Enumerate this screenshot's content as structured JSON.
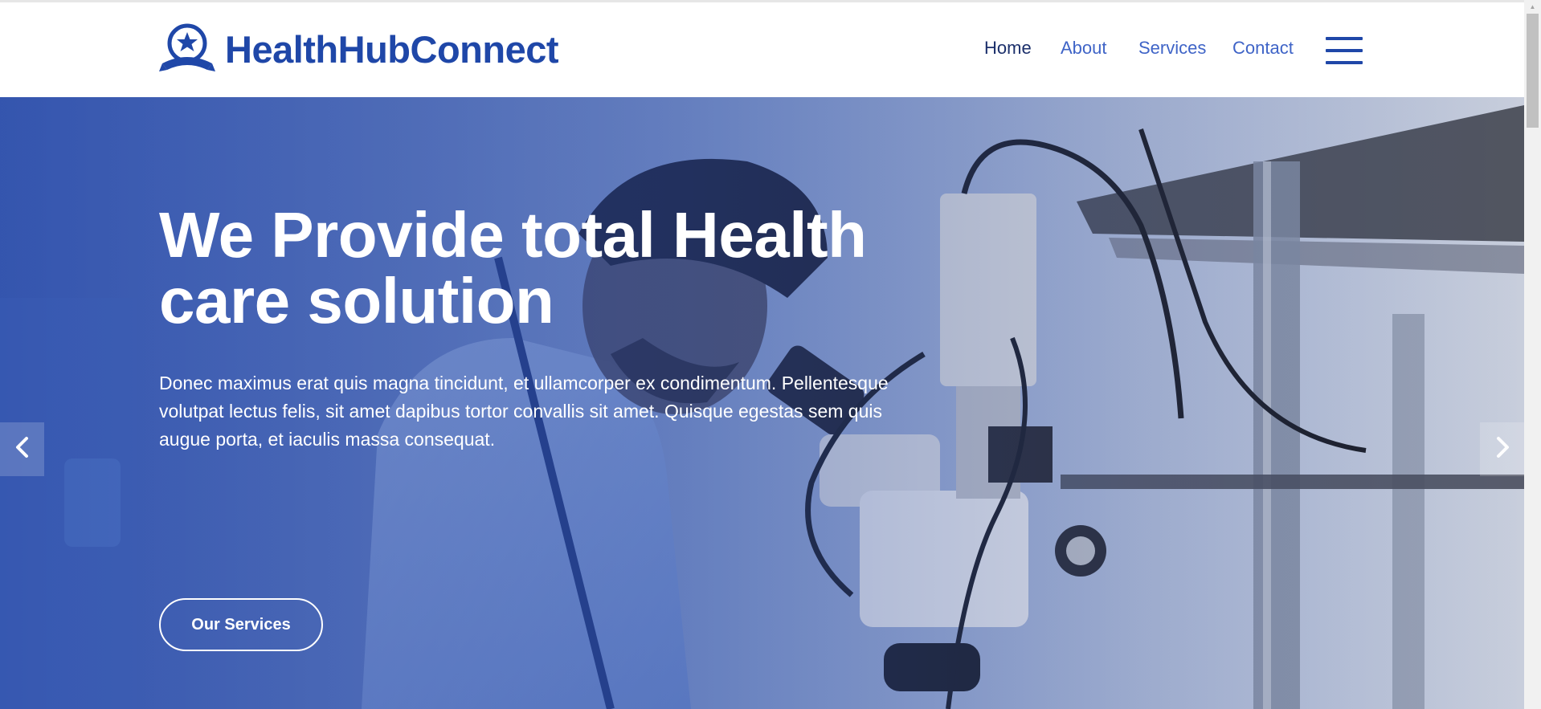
{
  "brand": {
    "name": "HealthHubConnect",
    "logo_icon": "medal-star-icon",
    "color": "#1f47a8"
  },
  "nav": {
    "items": [
      {
        "label": "Home",
        "active": true
      },
      {
        "label": "About",
        "active": false
      },
      {
        "label": "Services",
        "active": false
      },
      {
        "label": "Contact",
        "active": false
      }
    ],
    "menu_icon": "hamburger-menu-icon"
  },
  "hero": {
    "title": "We Provide total Health care solution",
    "text": "Donec maximus erat quis magna tincidunt, et ullamcorper ex condimentum. Pellentesque volutpat lectus felis, sit amet dapibus tortor convallis sit amet. Quisque egestas sem quis augue porta, et iaculis massa consequat.",
    "button_label": "Our Services",
    "prev_icon": "chevron-left-icon",
    "next_icon": "chevron-right-icon"
  },
  "colors": {
    "accent": "#1f47a8",
    "nav_link": "#3f64c7",
    "nav_active": "#1b2f6b"
  }
}
